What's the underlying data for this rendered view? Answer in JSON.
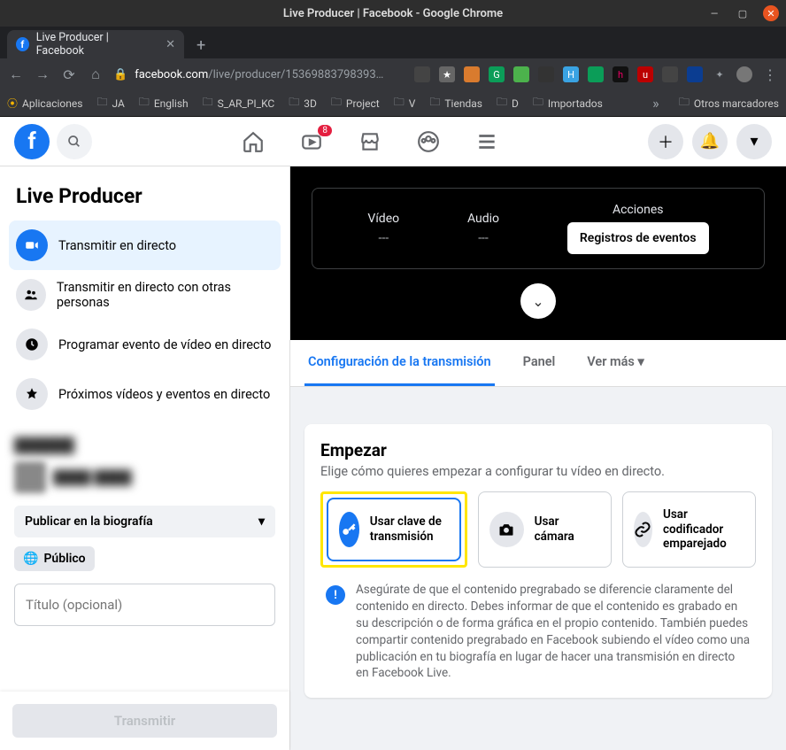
{
  "window": {
    "title": "Live Producer | Facebook - Google Chrome"
  },
  "browser": {
    "tab_title": "Live Producer | Facebook",
    "url_domain": "facebook.com",
    "url_path": "/live/producer/15369883798393…",
    "bookmarks_label": "Aplicaciones",
    "bookmarks": [
      "JA",
      "English",
      "S_AR_PI_KC",
      "3D",
      "Project",
      "V",
      "Tiendas",
      "D",
      "Importados"
    ],
    "other_bookmarks": "Otros marcadores"
  },
  "fb": {
    "badge": "8"
  },
  "sidebar": {
    "title": "Live Producer",
    "items": [
      {
        "label": "Transmitir en directo"
      },
      {
        "label": "Transmitir en directo con otras personas"
      },
      {
        "label": "Programar evento de vídeo en directo"
      },
      {
        "label": "Próximos vídeos y eventos en directo"
      }
    ],
    "post_to": "Publicar en la biografía",
    "audience": "Público",
    "title_placeholder": "Título (opcional)",
    "submit": "Transmitir"
  },
  "preview": {
    "video_label": "Vídeo",
    "video_val": "---",
    "audio_label": "Audio",
    "audio_val": "---",
    "actions_label": "Acciones",
    "events_btn": "Registros de eventos"
  },
  "tabs": {
    "t1": "Configuración de la transmisión",
    "t2": "Panel",
    "t3": "Ver más"
  },
  "card": {
    "title": "Empezar",
    "subtitle": "Elige cómo quieres empezar a configurar tu vídeo en directo.",
    "opt1": "Usar clave de transmisión",
    "opt2": "Usar cámara",
    "opt3": "Usar codificador emparejado",
    "info": "Asegúrate de que el contenido pregrabado se diferencie claramente del contenido en directo. Debes informar de que el contenido es grabado en su descripción o de forma gráfica en el propio contenido. También puedes compartir contenido pregrabado en Facebook subiendo el vídeo como una publicación en tu biografía en lugar de hacer una transmisión en directo en Facebook Live."
  }
}
